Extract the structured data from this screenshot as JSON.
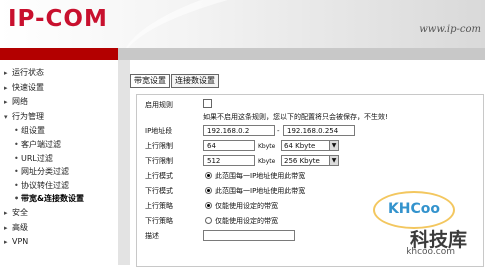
{
  "header": {
    "logo": "IP-COM",
    "url": "www.ip-com"
  },
  "sidebar": {
    "items": [
      {
        "label": "运行状态",
        "kind": "top"
      },
      {
        "label": "快速设置",
        "kind": "top"
      },
      {
        "label": "网络",
        "kind": "top"
      },
      {
        "label": "行为管理",
        "kind": "top-open"
      },
      {
        "label": "组设置",
        "kind": "sub"
      },
      {
        "label": "客户端过滤",
        "kind": "sub"
      },
      {
        "label": "URL过滤",
        "kind": "sub"
      },
      {
        "label": "网址分类过滤",
        "kind": "sub"
      },
      {
        "label": "协议转住过滤",
        "kind": "sub"
      },
      {
        "label": "带宽&连接数设置",
        "kind": "sub-active"
      },
      {
        "label": "安全",
        "kind": "top"
      },
      {
        "label": "高级",
        "kind": "top"
      },
      {
        "label": "VPN",
        "kind": "top"
      }
    ]
  },
  "tabs": [
    {
      "label": "带宽设置",
      "active": true
    },
    {
      "label": "连接数设置",
      "active": false
    }
  ],
  "form": {
    "enable_rule": {
      "label": "启用规则",
      "checked": false,
      "hint": "如果不启用这条规则，您以下的配置将只会被保存，不生效!"
    },
    "ip_range": {
      "label": "IP地址段",
      "start": "192.168.0.2",
      "separator": "-",
      "end": "192.168.0.254"
    },
    "upload_limit": {
      "label": "上行限制",
      "value": "64",
      "unit": "Kbyte",
      "select": "64 Kbyte"
    },
    "download_limit": {
      "label": "下行限制",
      "value": "512",
      "unit": "Kbyte",
      "select": "256 Kbyte"
    },
    "upload_mode": {
      "label": "上行模式",
      "option": "此范围每一IP地址使用此带宽",
      "selected": true
    },
    "download_mode": {
      "label": "下行模式",
      "option": "此范围每一IP地址使用此带宽",
      "selected": true
    },
    "upload_policy": {
      "label": "上行策略",
      "option": "仅能使用设定的带宽",
      "selected": true
    },
    "download_policy": {
      "label": "下行策略",
      "option": "仅能使用设定的带宽",
      "selected": false
    },
    "description": {
      "label": "描述",
      "value": ""
    }
  },
  "watermark": {
    "logo": "KHCoo",
    "cn": "科技库",
    "en": "khcoo.com"
  }
}
